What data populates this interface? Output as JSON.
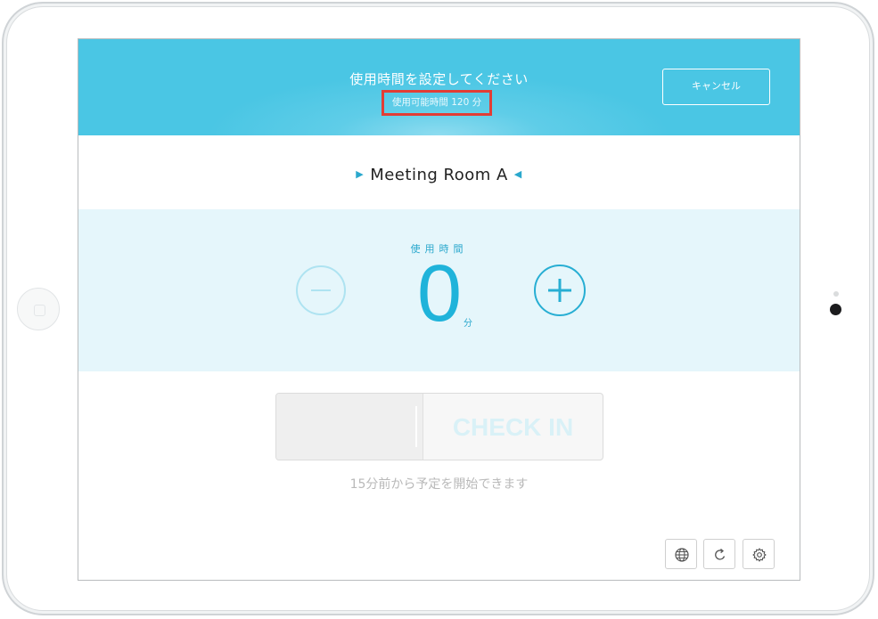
{
  "header": {
    "title": "使用時間を設定してください",
    "subtitle": "使用可能時間 120 分",
    "cancel_label": "キャンセル"
  },
  "room": {
    "name": "Meeting Room A",
    "prev_icon": "triangle-right-icon",
    "next_icon": "triangle-left-icon"
  },
  "duration": {
    "label": "使用時間",
    "value": "0",
    "unit": "分",
    "decrement_icon": "minus-circle-icon",
    "increment_icon": "plus-circle-icon"
  },
  "checkin": {
    "label": "CHECK IN",
    "hint": "15分前から予定を開始できます"
  },
  "toolbar": {
    "icons": [
      "globe-icon",
      "refresh-icon",
      "gear-icon"
    ]
  },
  "colors": {
    "header_blue": "#4ac6e4",
    "accent": "#27aed3",
    "panel_bg": "#e5f6fb",
    "highlight_border": "#e23d35"
  }
}
